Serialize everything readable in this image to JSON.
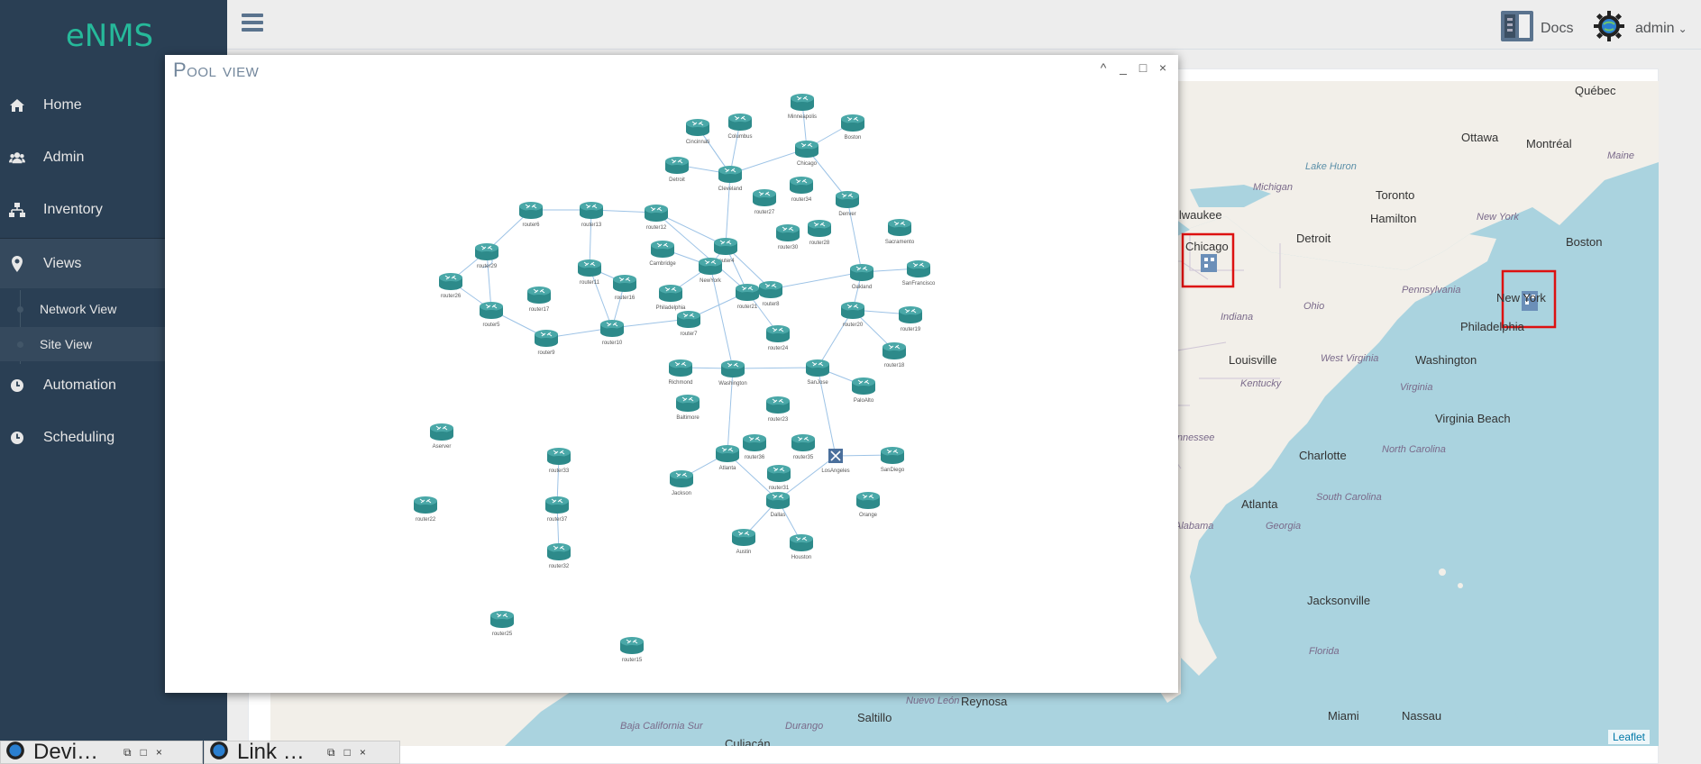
{
  "brand": "eNMS",
  "sidebar": {
    "items": [
      {
        "label": "Home",
        "icon": "home-icon"
      },
      {
        "label": "Admin",
        "icon": "users-icon"
      },
      {
        "label": "Inventory",
        "icon": "sitemap-icon"
      },
      {
        "label": "Views",
        "icon": "map-marker-icon"
      },
      {
        "label": "Automation",
        "icon": "clock-icon"
      },
      {
        "label": "Scheduling",
        "icon": "clock-icon"
      }
    ],
    "views_submenu": [
      {
        "label": "Network View"
      },
      {
        "label": "Site View"
      }
    ]
  },
  "topbar": {
    "docs_label": "Docs",
    "user_label": "admin"
  },
  "pool_window": {
    "title": "Pool view",
    "controls": [
      "^",
      "_",
      "□",
      "×"
    ]
  },
  "map": {
    "labels": {
      "quebec": "Québec",
      "ottawa": "Ottawa",
      "montreal": "Montréal",
      "maine": "Maine",
      "milwaukee": "ilwaukee",
      "michigan": "Michigan",
      "lake_huron": "Lake Huron",
      "toronto": "Toronto",
      "new_york_state": "New York",
      "detroit": "Detroit",
      "hamilton": "Hamilton",
      "boston": "Boston",
      "chicago": "Chicago",
      "new_york": "New York",
      "pennsylvania": "Pennsylvania",
      "ohio": "Ohio",
      "indiana": "Indiana",
      "philadelphia": "Philadelphia",
      "louisville": "Louisville",
      "west_virginia": "West Virginia",
      "washington": "Washington",
      "kentucky": "Kentucky",
      "virginia": "Virginia",
      "virginia_beach": "Virginia Beach",
      "tennessee": "Tennessee",
      "north_carolina": "North Carolina",
      "charlotte": "Charlotte",
      "atlanta": "Atlanta",
      "south_carolina": "South Carolina",
      "alabama": "Alabama",
      "georgia": "Georgia",
      "jacksonville": "Jacksonville",
      "florida": "Florida",
      "miami": "Miami",
      "nassau": "Nassau",
      "reynosa": "Reynosa",
      "nuevo_leon": "Nuevo León",
      "saltillo": "Saltillo",
      "durango": "Durango",
      "baja": "Baja California Sur",
      "culiacan": "Culiacán"
    },
    "attribution": "Leaflet"
  },
  "graph": {
    "nodes": [
      {
        "id": "Minneapolis",
        "label": "Minneapolis"
      },
      {
        "id": "Boston",
        "label": "Boston"
      },
      {
        "id": "Columbus",
        "label": "Columbus"
      },
      {
        "id": "Cincinnati",
        "label": "Cincinnati"
      },
      {
        "id": "Chicago",
        "label": "Chicago"
      },
      {
        "id": "Detroit",
        "label": "Detroit"
      },
      {
        "id": "Cleveland",
        "label": "Cleveland"
      },
      {
        "id": "router34",
        "label": "router34"
      },
      {
        "id": "router27",
        "label": "router27"
      },
      {
        "id": "Denver",
        "label": "Denver"
      },
      {
        "id": "router6",
        "label": "router6"
      },
      {
        "id": "router13",
        "label": "router13"
      },
      {
        "id": "router12",
        "label": "router12"
      },
      {
        "id": "router30",
        "label": "router30"
      },
      {
        "id": "router28",
        "label": "router28"
      },
      {
        "id": "Sacramento",
        "label": "Sacramento"
      },
      {
        "id": "router29",
        "label": "router29"
      },
      {
        "id": "Cambridge",
        "label": "Cambridge"
      },
      {
        "id": "router4",
        "label": "router4"
      },
      {
        "id": "router11",
        "label": "router11"
      },
      {
        "id": "NewYork",
        "label": "NewYork"
      },
      {
        "id": "router26",
        "label": "router26"
      },
      {
        "id": "router16",
        "label": "router16"
      },
      {
        "id": "Oakland",
        "label": "Oakland"
      },
      {
        "id": "SanFrancisco",
        "label": "SanFrancisco"
      },
      {
        "id": "router17",
        "label": "router17"
      },
      {
        "id": "Philadelphia",
        "label": "Philadelphia"
      },
      {
        "id": "router21",
        "label": "router21"
      },
      {
        "id": "router8",
        "label": "router8"
      },
      {
        "id": "router5",
        "label": "router5"
      },
      {
        "id": "router7",
        "label": "router7"
      },
      {
        "id": "router20",
        "label": "router20"
      },
      {
        "id": "router19",
        "label": "router19"
      },
      {
        "id": "router10",
        "label": "router10"
      },
      {
        "id": "router24",
        "label": "router24"
      },
      {
        "id": "router9",
        "label": "router9"
      },
      {
        "id": "router18",
        "label": "router18"
      },
      {
        "id": "Richmond",
        "label": "Richmond"
      },
      {
        "id": "Washington",
        "label": "Washington"
      },
      {
        "id": "SanJose",
        "label": "SanJose"
      },
      {
        "id": "PaloAlto",
        "label": "PaloAlto"
      },
      {
        "id": "Baltimore",
        "label": "Baltimore"
      },
      {
        "id": "router23",
        "label": "router23"
      },
      {
        "id": "Aserver",
        "label": "Aserver"
      },
      {
        "id": "router36",
        "label": "router36"
      },
      {
        "id": "router35",
        "label": "router35"
      },
      {
        "id": "LosAngeles",
        "label": "LosAngeles"
      },
      {
        "id": "SanDiego",
        "label": "SanDiego"
      },
      {
        "id": "router33",
        "label": "router33"
      },
      {
        "id": "Atlanta",
        "label": "Atlanta"
      },
      {
        "id": "router31",
        "label": "router31"
      },
      {
        "id": "Jackson",
        "label": "Jackson"
      },
      {
        "id": "router22",
        "label": "router22"
      },
      {
        "id": "router37",
        "label": "router37"
      },
      {
        "id": "Dallas",
        "label": "Dallas"
      },
      {
        "id": "Orange",
        "label": "Orange"
      },
      {
        "id": "Austin",
        "label": "Austin"
      },
      {
        "id": "Houston",
        "label": "Houston"
      },
      {
        "id": "router32",
        "label": "router32"
      },
      {
        "id": "router25",
        "label": "router25"
      },
      {
        "id": "router15",
        "label": "router15"
      }
    ],
    "links": [
      [
        "Minneapolis",
        "Chicago"
      ],
      [
        "Boston",
        "Chicago"
      ],
      [
        "Chicago",
        "Cleveland"
      ],
      [
        "Columbus",
        "Cleveland"
      ],
      [
        "Cincinnati",
        "Cleveland"
      ],
      [
        "Detroit",
        "Cleveland"
      ],
      [
        "Chicago",
        "Denver"
      ],
      [
        "Denver",
        "Oakland"
      ],
      [
        "Cleveland",
        "router4"
      ],
      [
        "router4",
        "router12"
      ],
      [
        "router12",
        "router13"
      ],
      [
        "router13",
        "router6"
      ],
      [
        "router6",
        "router29"
      ],
      [
        "router29",
        "router26"
      ],
      [
        "router26",
        "router5"
      ],
      [
        "router29",
        "router5"
      ],
      [
        "router5",
        "router9"
      ],
      [
        "router9",
        "router10"
      ],
      [
        "router10",
        "router11"
      ],
      [
        "router11",
        "router13"
      ],
      [
        "router11",
        "router16"
      ],
      [
        "router16",
        "router10"
      ],
      [
        "router10",
        "router7"
      ],
      [
        "router7",
        "router21"
      ],
      [
        "router21",
        "router4"
      ],
      [
        "router4",
        "NewYork"
      ],
      [
        "Cambridge",
        "NewYork"
      ],
      [
        "NewYork",
        "Philadelphia"
      ],
      [
        "NewYork",
        "Washington"
      ],
      [
        "router4",
        "router8"
      ],
      [
        "router8",
        "Oakland"
      ],
      [
        "Oakland",
        "SanFrancisco"
      ],
      [
        "Oakland",
        "router20"
      ],
      [
        "router20",
        "router19"
      ],
      [
        "router20",
        "router18"
      ],
      [
        "router20",
        "SanJose"
      ],
      [
        "router21",
        "router24"
      ],
      [
        "Washington",
        "Richmond"
      ],
      [
        "Washington",
        "SanJose"
      ],
      [
        "SanJose",
        "PaloAlto"
      ],
      [
        "SanJose",
        "LosAngeles"
      ],
      [
        "Washington",
        "Atlanta"
      ],
      [
        "Atlanta",
        "Jackson"
      ],
      [
        "Atlanta",
        "Dallas"
      ],
      [
        "LosAngeles",
        "SanDiego"
      ],
      [
        "LosAngeles",
        "Dallas"
      ],
      [
        "Dallas",
        "Austin"
      ],
      [
        "Dallas",
        "Houston"
      ],
      [
        "router33",
        "router37"
      ],
      [
        "router37",
        "router32"
      ],
      [
        "router12",
        "router21"
      ],
      [
        "Cleveland",
        "Cincinnati"
      ]
    ]
  }
}
